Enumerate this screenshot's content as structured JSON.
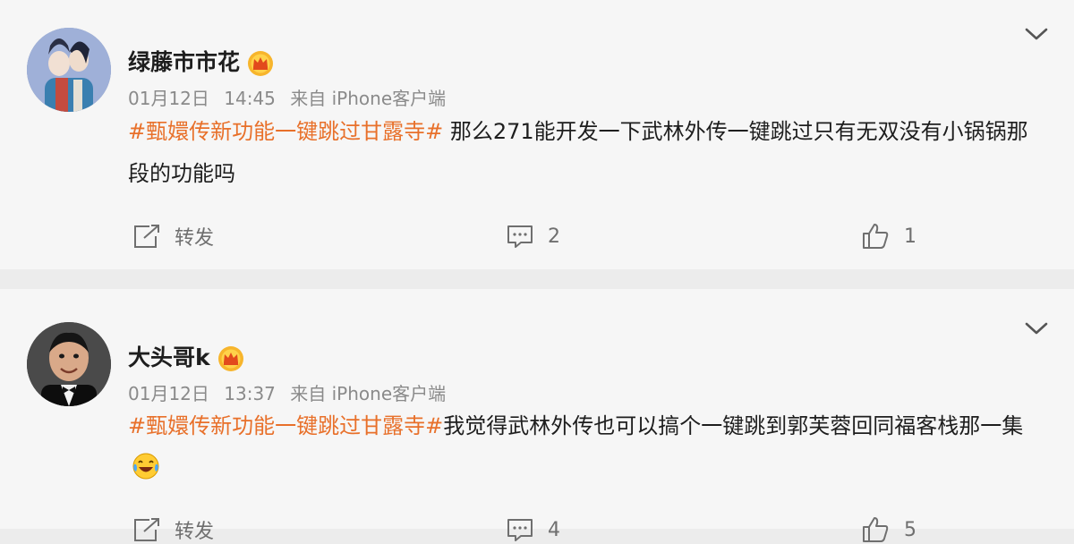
{
  "comments": [
    {
      "username": "绿藤市市花",
      "date": "01月12日",
      "time": "14:45",
      "source": "来自 iPhone客户端",
      "topic": "#甄嬛传新功能一键跳过甘露寺#",
      "text": " 那么271能开发一下武林外传一键跳过只有无双没有小锅锅那段的功能吗",
      "repost_label": "转发",
      "comment_count": "2",
      "like_count": "1"
    },
    {
      "username": "大头哥k",
      "date": "01月12日",
      "time": "13:37",
      "source": "来自 iPhone客户端",
      "topic": "#甄嬛传新功能一键跳过甘露寺#",
      "text": "我觉得武林外传也可以搞个一键跳到郭芙蓉回同福客栈那一集",
      "repost_label": "转发",
      "comment_count": "4",
      "like_count": "5"
    }
  ],
  "colors": {
    "topic": "#e8702a",
    "background": "#ececec",
    "card": "#f6f6f6"
  },
  "icons": {
    "badge": "crown-icon",
    "menu": "chevron-down-icon",
    "repost": "share-icon",
    "comment": "comment-icon",
    "like": "thumbs-up-icon",
    "emoji": "laughing-crying-emoji"
  }
}
